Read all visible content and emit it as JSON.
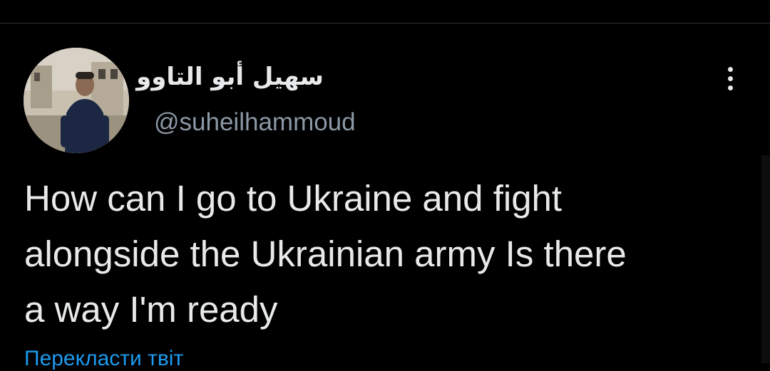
{
  "tweet": {
    "author": {
      "display_name": "سهيل أبو التاوو",
      "handle": "@suheilhammoud",
      "avatar_icon": "user-avatar-photo"
    },
    "text": "How can I go to Ukraine and fight\nalongside the Ukrainian army Is there\na way I'm ready",
    "translate_label": "Перекласти твіт",
    "more_icon": "more-vertical-icon"
  },
  "colors": {
    "background": "#000000",
    "text_primary": "#e7e9ea",
    "text_secondary": "#8b98a5",
    "link": "#1d9bf0",
    "divider": "#2f3336"
  }
}
